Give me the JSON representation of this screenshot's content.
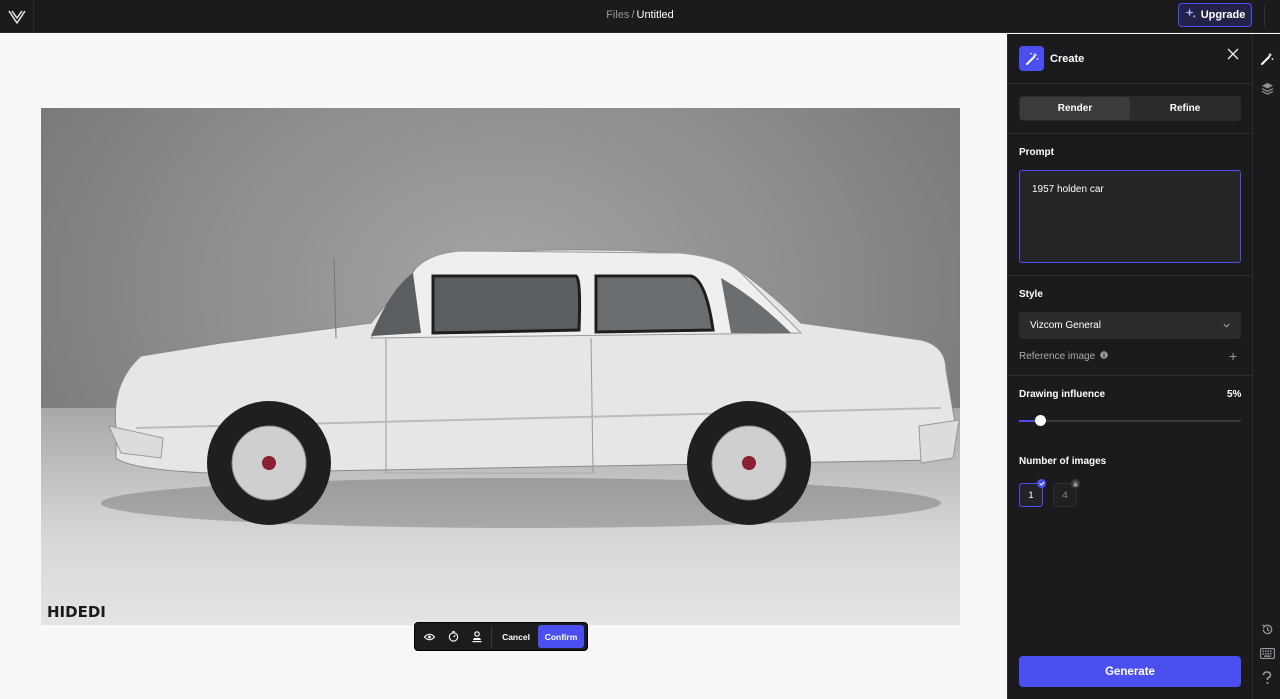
{
  "header": {
    "breadcrumb_root": "Files",
    "breadcrumb_separator": "/",
    "document_title": "Untitled",
    "upgrade_label": "Upgrade",
    "logo_icon": "vizcom-logo-icon",
    "upgrade_icon": "sparkle-icon"
  },
  "canvas": {
    "image_watermark": "HIDEDI"
  },
  "toolbar": {
    "icons": [
      "eye-icon",
      "timer-icon",
      "stamp-icon"
    ],
    "cancel_label": "Cancel",
    "confirm_label": "Confirm"
  },
  "panel": {
    "title": "Create",
    "tabs": [
      {
        "label": "Render",
        "active": true
      },
      {
        "label": "Refine",
        "active": false
      }
    ],
    "prompt_label": "Prompt",
    "prompt_value": "1957 holden car",
    "style_label": "Style",
    "style_value": "Vizcom General",
    "reference_label": "Reference image",
    "influence_label": "Drawing influence",
    "influence_value": "5%",
    "influence_fraction": 0.05,
    "images_label": "Number of images",
    "image_counts": [
      "1",
      "4"
    ],
    "generate_label": "Generate"
  },
  "rail": {
    "top_icons": [
      "magic-wand-icon",
      "layers-icon"
    ],
    "bottom_icons": [
      "history-icon",
      "keyboard-icon",
      "help-icon"
    ]
  },
  "colors": {
    "accent": "#4b4ff0",
    "panel_bg": "#1b1b1d",
    "canvas_bg": "#f8f8f8"
  }
}
